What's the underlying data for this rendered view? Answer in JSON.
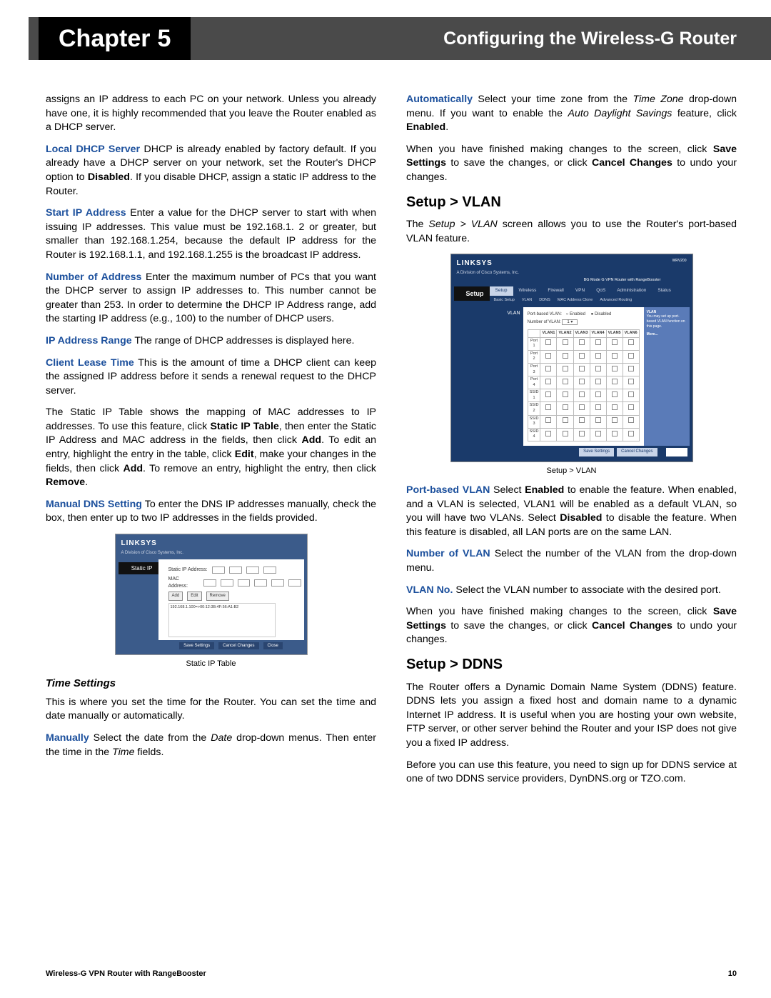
{
  "header": {
    "chapter_label": "Chapter",
    "chapter_number": "5",
    "title": "Configuring the Wireless-G Router"
  },
  "col1": {
    "p1": "assigns an IP address to each PC on your network. Unless you already have one, it is highly recommended that you leave the Router enabled as a DHCP server.",
    "local_dhcp_label": "Local DHCP Server",
    "local_dhcp_text": "  DHCP is already enabled by factory default. If you already have a DHCP server on your network, set the Router's DHCP option to ",
    "disabled": "Disabled",
    "local_dhcp_tail": ". If you disable DHCP, assign a static IP address to the Router.",
    "start_ip_label": "Start IP Address",
    "start_ip_text": " Enter a value for the DHCP server to start with when issuing IP addresses. This value must be 192.168.1. 2 or greater, but smaller than 192.168.1.254, because the default IP address for the Router is 192.168.1.1, and 192.168.1.255 is the broadcast IP address.",
    "num_addr_label": "Number of Address",
    "num_addr_text": "  Enter the maximum number of PCs that you want the DHCP server to assign IP addresses to. This number cannot be greater than 253. In order to determine the DHCP IP Address range, add the starting IP address (e.g., 100) to the number of DHCP users.",
    "ip_range_label": "IP Address Range",
    "ip_range_text": " The range of DHCP addresses is displayed here.",
    "lease_label": "Client Lease Time",
    "lease_text": "  This is the amount of time a DHCP client can keep the assigned IP address before it sends a renewal request to the DHCP server.",
    "static_pre": "The Static IP Table shows the mapping of MAC addresses to IP addresses. To use this feature, click ",
    "static_ip_table": "Static IP Table",
    "static_mid1": ", then enter the Static IP Address and MAC address in the fields, then click ",
    "add": "Add",
    "static_mid2": ". To edit an entry, highlight the entry in the table, click ",
    "edit": "Edit",
    "static_mid3": ", make your changes in the fields, then click ",
    "static_mid4": ". To remove an entry, highlight the entry, then click ",
    "remove": "Remove",
    "period": ".",
    "manual_dns_label": "Manual DNS Setting",
    "manual_dns_text": " To enter the DNS IP addresses manually, check the box, then enter up to two IP addresses in the fields provided.",
    "fig1_brand": "LINKSYS",
    "fig1_tab": "Static IP",
    "fig1_field1": "Static IP Address:",
    "fig1_field2": "MAC Address:",
    "fig1_btn_add": "Add",
    "fig1_btn_edit": "Edit",
    "fig1_btn_remove": "Remove",
    "fig1_entry": "192.168.1.100=>00:12:3B:4F:56:A1:B2",
    "fig1_footer_save": "Save Settings",
    "fig1_footer_cancel": "Cancel Changes",
    "fig1_footer_close": "Close",
    "fig1_caption": "Static IP Table",
    "time_heading": "Time Settings",
    "time_p1": "This is where you set the time for the Router. You can set the time and date manually or automatically.",
    "manually_label": "Manually",
    "manually_text": " Select the date from the ",
    "date_i": "Date",
    "manually_tail": " drop-down menus. Then enter the time in the ",
    "time_i": "Time",
    "manually_end": " fields."
  },
  "col2": {
    "auto_label": "Automatically",
    "auto_text1": "  Select your time zone from the ",
    "timezone_i": "Time Zone",
    "auto_text2": " drop-down menu. If you want to enable the ",
    "ads_i": "Auto Daylight Savings",
    "auto_text3": " feature, click ",
    "enabled": "Enabled",
    "save_para_1": "When you have finished making changes to the screen, click ",
    "save_settings": "Save Settings",
    "save_para_2": " to save the changes, or click ",
    "cancel_changes": "Cancel Changes",
    "save_para_3": " to undo your changes.",
    "vlan_heading": "Setup > VLAN",
    "vlan_intro_1": "The ",
    "vlan_intro_i": "Setup > VLAN",
    "vlan_intro_2": " screen allows you to use the Router's port-based VLAN feature.",
    "fig2_brand": "LINKSYS",
    "fig2_title_right": "BG Mode G VPN Router with RangeBooster",
    "fig2_model": "WRV200",
    "fig2_setup": "Setup",
    "fig2_tabs": [
      "Setup",
      "Wireless",
      "Firewall",
      "VPN",
      "QoS",
      "Administration",
      "Status"
    ],
    "fig2_subtabs": [
      "Basic Setup",
      "VLAN",
      "DDNS",
      "MAC Address Clone",
      "Advanced Routing"
    ],
    "fig2_side": "VLAN",
    "fig2_pbv": "Port-based VLAN:",
    "fig2_enabled": "Enabled",
    "fig2_disabled": "Disabled",
    "fig2_numvlan": "Number of VLAN:",
    "fig2_table_headers": [
      "",
      "VLAN1",
      "VLAN2",
      "VLAN3",
      "VLAN4",
      "VLAN5",
      "VLAN6"
    ],
    "fig2_rows": [
      "Port 1",
      "Port 2",
      "Port 3",
      "Port 4",
      "SSID 1",
      "SSID 2",
      "SSID 3",
      "SSID 4"
    ],
    "fig2_help_title": "VLAN",
    "fig2_help_body": "You may set up port-based VLAN function on this page.",
    "fig2_more": "More...",
    "fig2_save": "Save Settings",
    "fig2_cancel": "Cancel Changes",
    "fig2_caption": "Setup > VLAN",
    "pbv_label": "Port-based VLAN",
    "pbv_text1": "  Select ",
    "pbv_text2": " to enable the feature. When enabled, and a VLAN is selected, VLAN1 will be enabled as a default VLAN, so you will have two VLANs. Select ",
    "pbv_text3": " to disable the feature. When this feature is disabled, all LAN ports are on the same LAN.",
    "nov_label": "Number of VLAN",
    "nov_text": "  Select the number of the VLAN from the drop-down menu.",
    "vno_label": "VLAN No.",
    "vno_text": "  Select the VLAN number to associate with the desired port.",
    "ddns_heading": "Setup > DDNS",
    "ddns_p1": "The Router offers a Dynamic Domain Name System (DDNS) feature. DDNS lets you assign a fixed host and domain name to a dynamic Internet IP address. It is useful when you are hosting your own website, FTP server, or other server behind the Router and your ISP does not give you a fixed IP address.",
    "ddns_p2": "Before you can use this feature, you need to sign up for DDNS service at one of two DDNS service providers, DynDNS.org or TZO.com."
  },
  "footer": {
    "left": "Wireless-G VPN Router with RangeBooster",
    "right": "10"
  }
}
